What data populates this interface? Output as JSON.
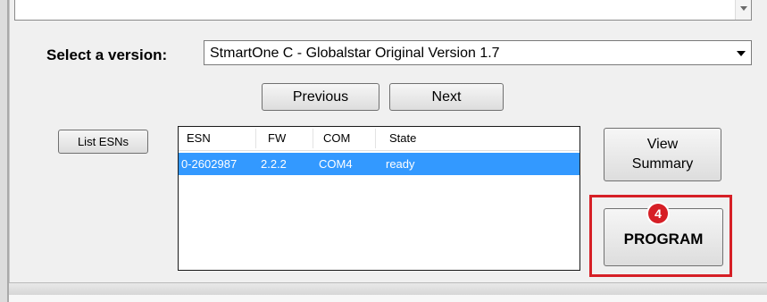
{
  "version": {
    "label": "Select a version:",
    "selected": "StmartOne C - Globalstar Original Version 1.7"
  },
  "nav": {
    "previous_label": "Previous",
    "next_label": "Next"
  },
  "list_esns_label": "List ESNs",
  "esn_table": {
    "columns": [
      "ESN",
      "FW",
      "COM",
      "State"
    ],
    "rows": [
      {
        "esn": "0-2602987",
        "fw": "2.2.2",
        "com": "COM4",
        "state": "ready",
        "selected": true
      }
    ]
  },
  "view_summary_label": [
    "View",
    "Summary"
  ],
  "program": {
    "label": "PROGRAM",
    "step_number": "4",
    "highlight_color": "#d61f26"
  },
  "colors": {
    "selection": "#3399ff"
  }
}
